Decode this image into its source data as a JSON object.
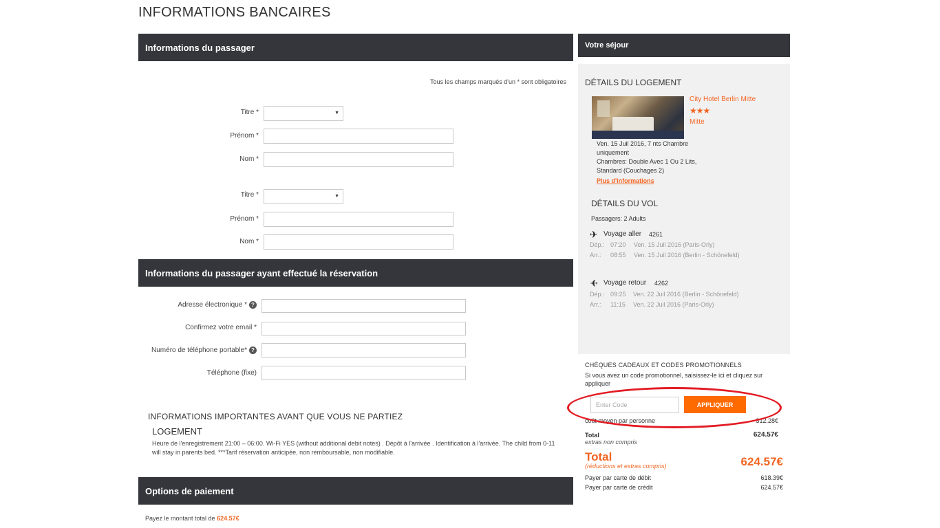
{
  "page_title": "INFORMATIONS BANCAIRES",
  "passenger_section": {
    "title": "Informations du passager",
    "required_note": "Tous les champs marqués d'un * sont obligatoires",
    "passengers": [
      {
        "title_label": "Titre *",
        "title_value": "",
        "first_name_label": "Prénom *",
        "first_name_value": "",
        "last_name_label": "Nom *",
        "last_name_value": ""
      },
      {
        "title_label": "Titre *",
        "title_value": "",
        "first_name_label": "Prénom *",
        "first_name_value": "",
        "last_name_label": "Nom *",
        "last_name_value": ""
      }
    ]
  },
  "booker_section": {
    "title": "Informations du passager ayant effectué la réservation",
    "email_label": "Adresse électronique *",
    "confirm_email_label": "Confirmez votre email *",
    "mobile_label": "Numéro de téléphone portable*",
    "phone_label": "Téléphone (fixe)",
    "help_glyph": "?"
  },
  "important_info": {
    "title": "INFORMATIONS IMPORTANTES AVANT QUE VOUS NE PARTIEZ",
    "subtitle": "LOGEMENT",
    "text": "Heure de l'enregistrement 21:00 – 06:00. Wi-Fi YES (without additional debit notes) . Dépôt à l'arrivée . Identification à l'arrivée. The child from 0-11 will stay in parents bed. ***Tarif réservation anticipée, non remboursable, non modifiable."
  },
  "payment_section": {
    "title": "Options de paiement",
    "total_text": "Payez le montant total de",
    "total_amount": "624.57€"
  },
  "sidebar": {
    "title": "Votre séjour",
    "lodging_heading": "DÉTAILS DU LOGEMENT",
    "hotel": {
      "name": "City Hotel Berlin Mitte",
      "stars": "★★★",
      "location": "Mitte",
      "dates": "Ven. 15 Juil 2016, 7 nts Chambre uniquement",
      "rooms": "Chambres: Double Avec 1 Ou 2 Lits, Standard (Couchages 2)",
      "more_link": "Plus d'informations"
    },
    "flight_heading": "DÉTAILS DU VOL",
    "passengers_text": "Passagers: 2 Adults",
    "outbound": {
      "label": "Voyage aller",
      "number": "4261",
      "dep_label": "Dép.:",
      "dep_time": "07:20",
      "dep_info": "Ven. 15 Juil 2016 (Paris-Orly)",
      "arr_label": "Arr.:",
      "arr_time": "08:55",
      "arr_info": "Ven. 15 Juil 2016 (Berlin - Schönefeld)"
    },
    "return": {
      "label": "Voyage retour",
      "number": "4262",
      "dep_label": "Dép.:",
      "dep_time": "09:25",
      "dep_info": "Ven. 22 Juil 2016 (Berlin - Schönefeld)",
      "arr_label": "Arr.:",
      "arr_time": "11:15",
      "arr_info": "Ven. 22 Juil 2016 (Paris-Orly)"
    },
    "plane_icon": "airplane-icon"
  },
  "promo": {
    "title": "CHÈQUES CADEAUX ET CODES PROMOTIONNELS",
    "text": "Si vous avez un code promotionnel, saisissez-le ici et cliquez sur appliquer",
    "placeholder": "Enter Code",
    "apply_label": "APPLIQUER",
    "highlight_color": "#e31b23"
  },
  "summary": {
    "avg_label": "coût moyen par personne",
    "avg_value": "312.28€",
    "total_label": "Total",
    "total_note": "extras non compris",
    "total_value": "624.57€",
    "grand_total_label": "Total",
    "grand_total_note": "(réductions et extras compris)",
    "grand_total_value": "624.57€",
    "debit_label": "Payer par carte de débit",
    "debit_value": "618.39€",
    "credit_label": "Payer par carte de crédit",
    "credit_value": "624.57€"
  },
  "colors": {
    "accent": "#f26522",
    "button": "#ff6a00",
    "bar": "#35363b",
    "panel": "#f1f1f2"
  }
}
